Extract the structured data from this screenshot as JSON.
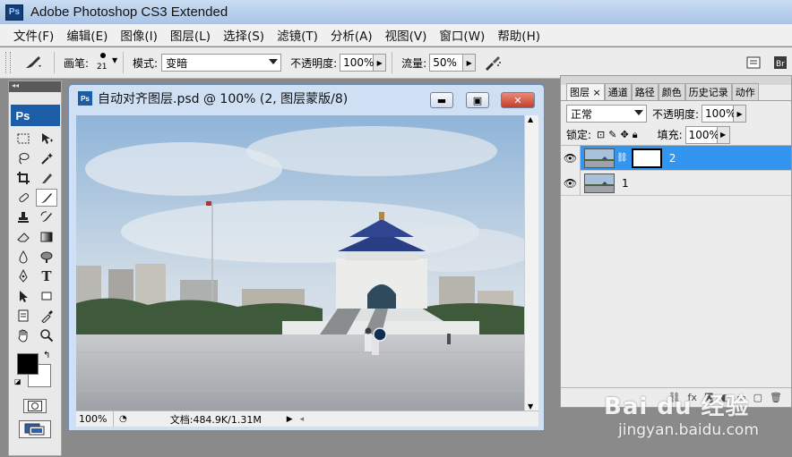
{
  "app": {
    "logo": "Ps",
    "title": "Adobe Photoshop CS3 Extended"
  },
  "menu": [
    "文件(F)",
    "编辑(E)",
    "图像(I)",
    "图层(L)",
    "选择(S)",
    "滤镜(T)",
    "分析(A)",
    "视图(V)",
    "窗口(W)",
    "帮助(H)"
  ],
  "options": {
    "brush_label": "画笔:",
    "brush_size": "21",
    "mode_label": "模式:",
    "mode_value": "变暗",
    "opacity_label": "不透明度:",
    "opacity_value": "100%",
    "flow_label": "流量:",
    "flow_value": "50%"
  },
  "toolbox": {
    "logo": "Ps",
    "foreground_color": "#000000",
    "background_color": "#ffffff"
  },
  "document": {
    "icon": "Ps",
    "title": "自动对齐图层.psd @ 100% (2, 图层蒙版/8)",
    "zoom": "100%",
    "info": "文档:484.9K/1.31M"
  },
  "layers_panel": {
    "tabs": [
      "图层",
      "通道",
      "路径",
      "颜色",
      "历史记录",
      "动作"
    ],
    "blend_mode": "正常",
    "opacity_label": "不透明度:",
    "opacity_value": "100%",
    "lock_label": "锁定:",
    "fill_label": "填充:",
    "fill_value": "100%",
    "layers": [
      {
        "name": "2",
        "visible": true,
        "selected": true,
        "has_mask": true
      },
      {
        "name": "1",
        "visible": true,
        "selected": false,
        "has_mask": false
      }
    ]
  },
  "watermark": {
    "main": "Bai du 经验",
    "sub": "jingyan.baidu.com"
  }
}
